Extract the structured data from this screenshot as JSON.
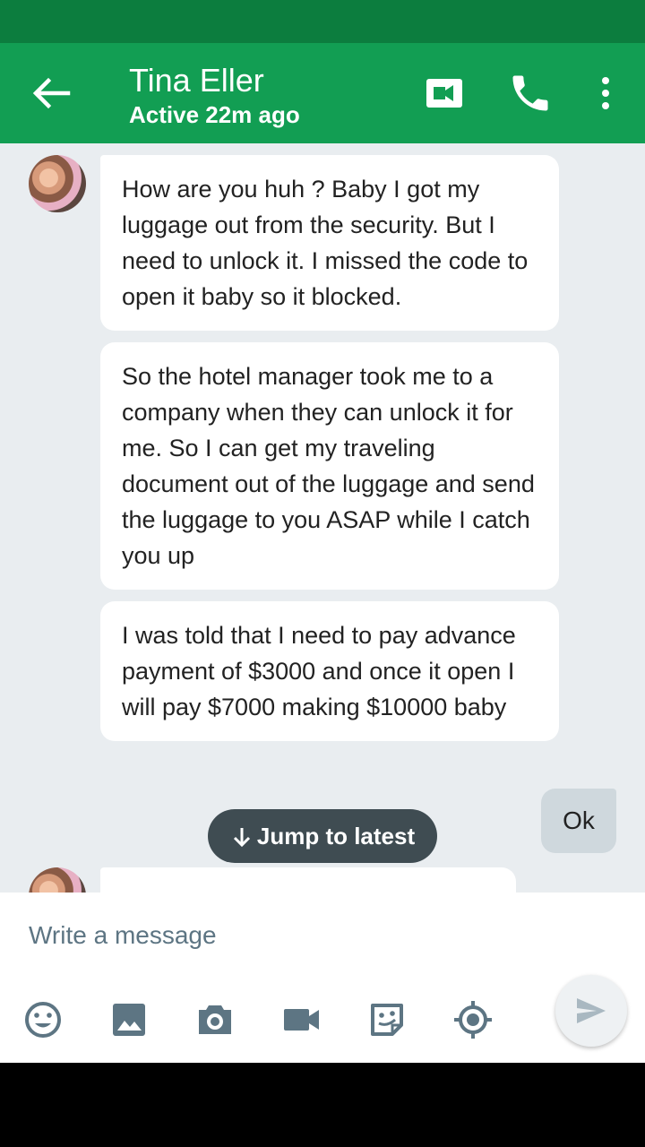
{
  "header": {
    "contact_name": "Tina Eller",
    "contact_status": "Active 22m ago",
    "icons": [
      "back-arrow-icon",
      "video-call-icon",
      "phone-icon",
      "more-vert-icon"
    ]
  },
  "messages": [
    {
      "direction": "incoming",
      "text": "How are you huh ? Baby I got my luggage out from the security. But I need to unlock it. I missed the code to open it baby so it blocked."
    },
    {
      "direction": "incoming",
      "text": "So the hotel manager took me to a company when they can unlock it for me. So I can get my traveling document out of the luggage and send the luggage to you ASAP while I catch you up"
    },
    {
      "direction": "incoming",
      "text": "I was told that I need to pay advance payment of $3000 and once it open I will pay $7000 making $10000 baby"
    },
    {
      "direction": "outgoing",
      "text": "Ok"
    }
  ],
  "jump_to_latest": "Jump to latest",
  "composer": {
    "placeholder": "Write a message",
    "tools": [
      "emoji-icon",
      "image-icon",
      "camera-icon",
      "video-icon",
      "sticker-icon",
      "location-icon"
    ],
    "send_icon": "send-icon"
  },
  "colors": {
    "app_bar": "#129e53",
    "status_bar": "#0c7d3e",
    "chat_background": "#e9edf0",
    "outgoing_bubble": "#cfd8dd",
    "icon_gray": "#5d7583"
  }
}
